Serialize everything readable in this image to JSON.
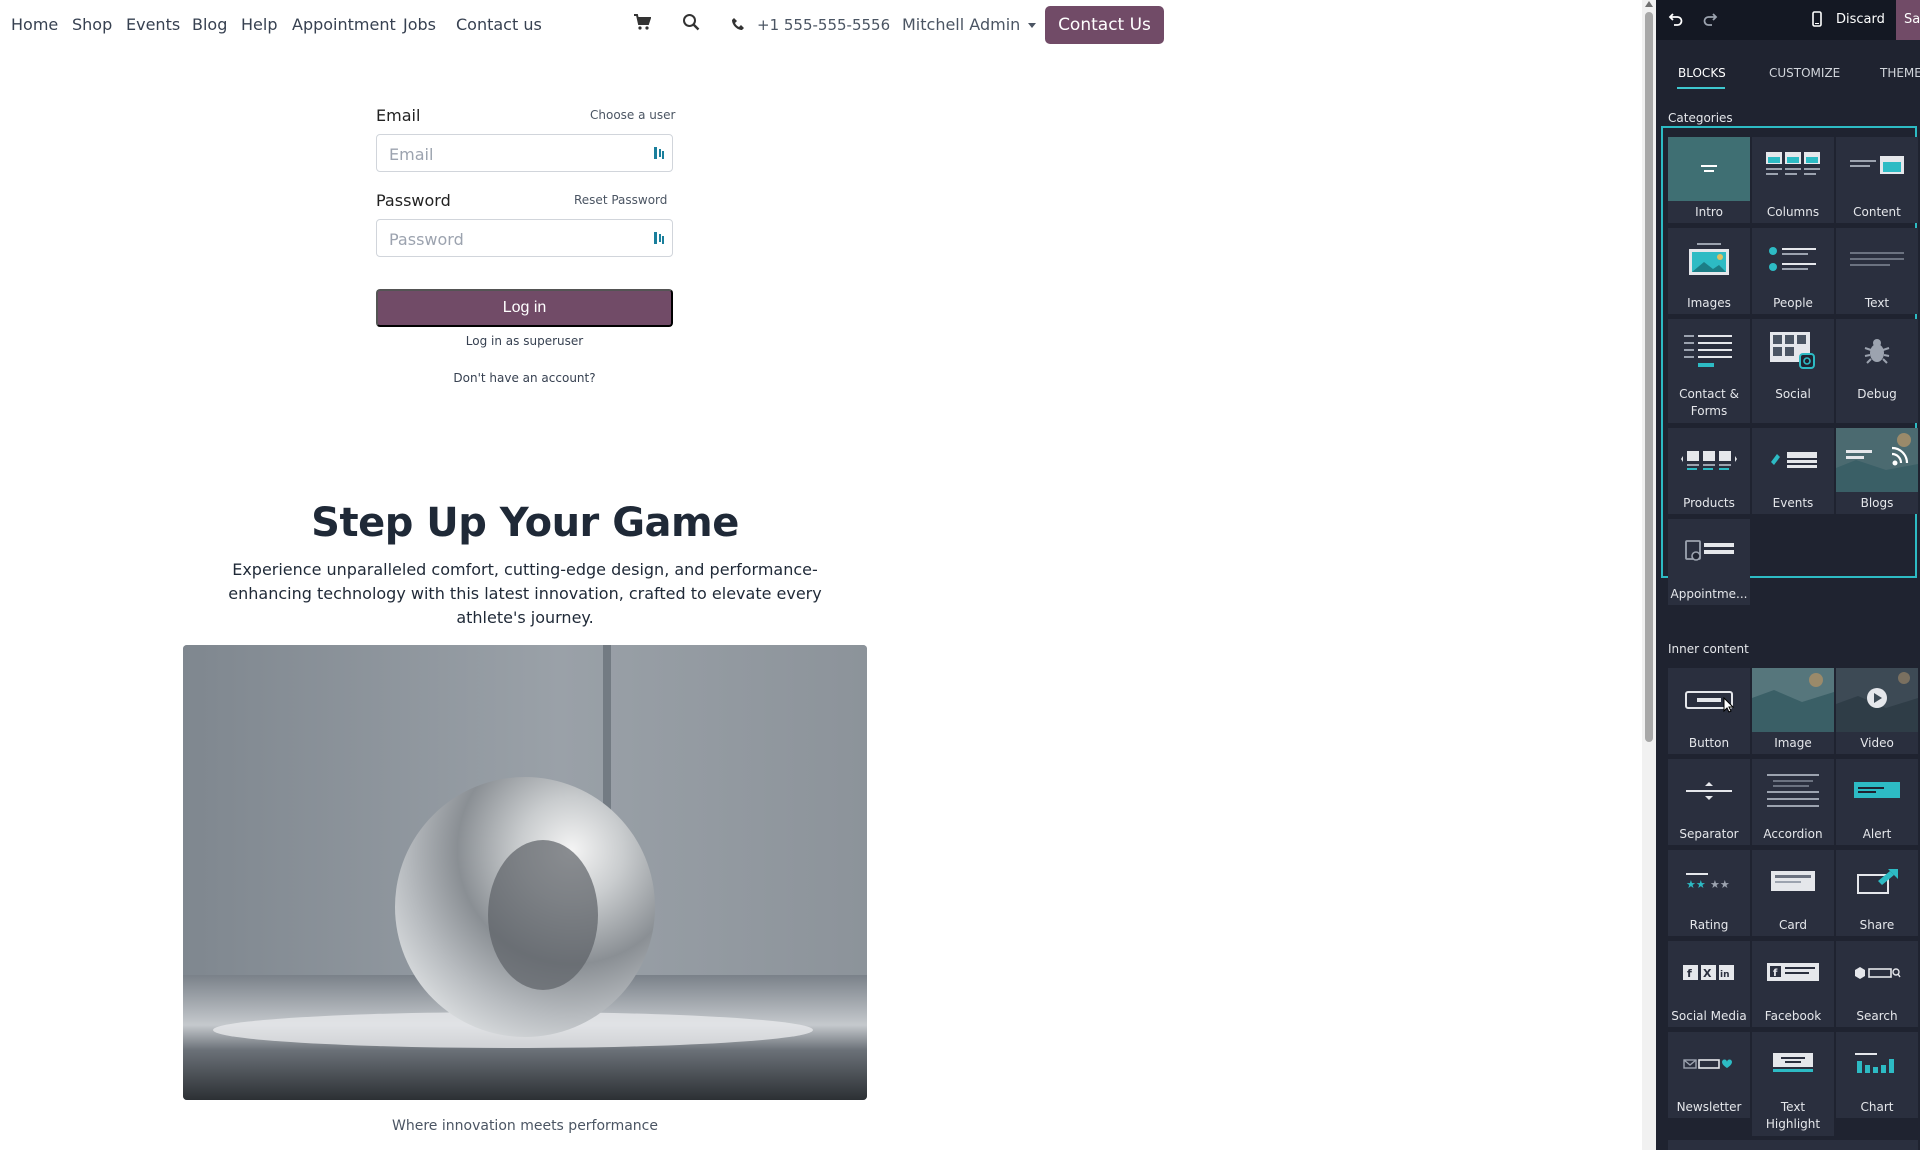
{
  "nav": {
    "links": [
      "Home",
      "Shop",
      "Events",
      "Blog",
      "Help",
      "Appointment",
      "Jobs",
      "Contact us"
    ],
    "phone": "+1 555-555-5556",
    "user": "Mitchell Admin",
    "cta": "Contact Us"
  },
  "login": {
    "email_label": "Email",
    "choose_user": "Choose a user",
    "email_placeholder": "Email",
    "password_label": "Password",
    "reset_password": "Reset Password",
    "password_placeholder": "Password",
    "login_button": "Log in",
    "superuser_link": "Log in as superuser",
    "signup_link": "Don't have an account?"
  },
  "hero": {
    "title": "Step Up Your Game",
    "description": "Experience unparalleled comfort, cutting-edge design, and performance-enhancing technology with this latest innovation, crafted to elevate every athlete's journey.",
    "caption": "Where innovation meets performance"
  },
  "editor": {
    "discard": "Discard",
    "save": "Save",
    "tabs": [
      "BLOCKS",
      "CUSTOMIZE",
      "THEME"
    ],
    "categories_title": "Categories",
    "categories": [
      {
        "label": "Intro",
        "icon": "intro-icon"
      },
      {
        "label": "Columns",
        "icon": "columns-icon"
      },
      {
        "label": "Content",
        "icon": "content-icon"
      },
      {
        "label": "Images",
        "icon": "images-icon"
      },
      {
        "label": "People",
        "icon": "people-icon"
      },
      {
        "label": "Text",
        "icon": "text-icon"
      },
      {
        "label": "Contact & Forms",
        "icon": "contact-forms-icon"
      },
      {
        "label": "Social",
        "icon": "social-icon"
      },
      {
        "label": "Debug",
        "icon": "debug-icon"
      },
      {
        "label": "Products",
        "icon": "products-icon"
      },
      {
        "label": "Events",
        "icon": "events-icon"
      },
      {
        "label": "Blogs",
        "icon": "blogs-icon"
      },
      {
        "label": "Appointme...",
        "icon": "appointment-icon"
      }
    ],
    "inner_title": "Inner content",
    "inner": [
      {
        "label": "Button",
        "icon": "button-icon"
      },
      {
        "label": "Image",
        "icon": "image-icon"
      },
      {
        "label": "Video",
        "icon": "video-icon"
      },
      {
        "label": "Separator",
        "icon": "separator-icon"
      },
      {
        "label": "Accordion",
        "icon": "accordion-icon"
      },
      {
        "label": "Alert",
        "icon": "alert-icon"
      },
      {
        "label": "Rating",
        "icon": "rating-icon"
      },
      {
        "label": "Card",
        "icon": "card-icon"
      },
      {
        "label": "Share",
        "icon": "share-icon"
      },
      {
        "label": "Social Media",
        "icon": "social-media-icon"
      },
      {
        "label": "Facebook",
        "icon": "facebook-icon"
      },
      {
        "label": "Search",
        "icon": "search-block-icon"
      },
      {
        "label": "Newsletter",
        "icon": "newsletter-icon"
      },
      {
        "label": "Text Highlight",
        "icon": "text-highlight-icon"
      },
      {
        "label": "Chart",
        "icon": "chart-icon"
      }
    ]
  },
  "colors": {
    "brand": "#714b67",
    "panel_bg": "#1f2330",
    "accent": "#2dbbc4"
  }
}
